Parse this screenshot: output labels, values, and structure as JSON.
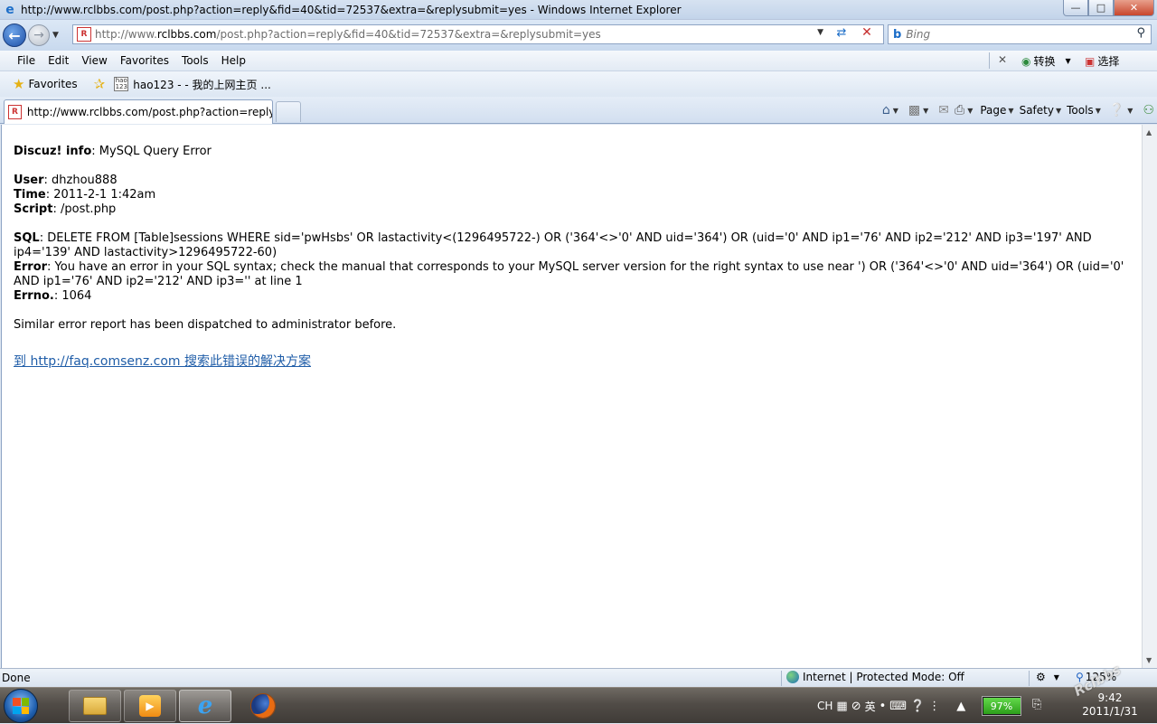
{
  "window": {
    "title": "http://www.rclbbs.com/post.php?action=reply&fid=40&tid=72537&extra=&replysubmit=yes - Windows Internet Explorer"
  },
  "address": {
    "prefix": "http://www.",
    "domain": "rclbbs.com",
    "path": "/post.php?action=reply&fid=40&tid=72537&extra=&replysubmit=yes"
  },
  "search": {
    "placeholder": "Bing"
  },
  "menu": [
    "File",
    "Edit",
    "View",
    "Favorites",
    "Tools",
    "Help"
  ],
  "translate": {
    "convert_label": "转换",
    "select_label": "选择"
  },
  "favorites": {
    "label": "Favorites",
    "link_label": "hao123 - - 我的上网主页 ...",
    "link_icon_text": "hao 123"
  },
  "tab": {
    "label": "http://www.rclbbs.com/post.php?action=reply&..."
  },
  "commands": {
    "page": "Page",
    "safety": "Safety",
    "tools": "Tools"
  },
  "error": {
    "title_label": "Discuz! info",
    "title_value": ": MySQL Query Error",
    "user_label": "User",
    "user_value": ": dhzhou888",
    "time_label": "Time",
    "time_value": ": 2011-2-1 1:42am",
    "script_label": "Script",
    "script_value": ": /post.php",
    "sql_label": "SQL",
    "sql_value": ": DELETE FROM [Table]sessions WHERE sid='pwHsbs' OR lastactivity<(1296495722-) OR ('364'<>'0' AND uid='364') OR (uid='0' AND ip1='76' AND ip2='212' AND ip3='197' AND ip4='139' AND lastactivity>1296495722-60)",
    "error_label": "Error",
    "error_value": ": You have an error in your SQL syntax; check the manual that corresponds to your MySQL server version for the right syntax to use near ') OR ('364'<>'0' AND uid='364') OR (uid='0' AND ip1='76' AND ip2='212' AND ip3='' at line 1",
    "errno_label": "Errno.",
    "errno_value": ": 1064",
    "dispatch_note": "Similar error report has been dispatched to administrator before.",
    "faq_link": "到  http://faq.comsenz.com 搜索此错误的解决方案"
  },
  "status": {
    "text": "Done",
    "zone": "Internet | Protected Mode: Off",
    "zoom": "125%"
  },
  "tray": {
    "lang": "CH",
    "ime": "英",
    "battery_percent": 97,
    "battery_label": "97%",
    "time": "9:42",
    "date": "2011/1/31"
  },
  "watermark": "Rclbbs",
  "colors": {
    "link": "#1f5da8",
    "accent": "#1e6fc9"
  }
}
